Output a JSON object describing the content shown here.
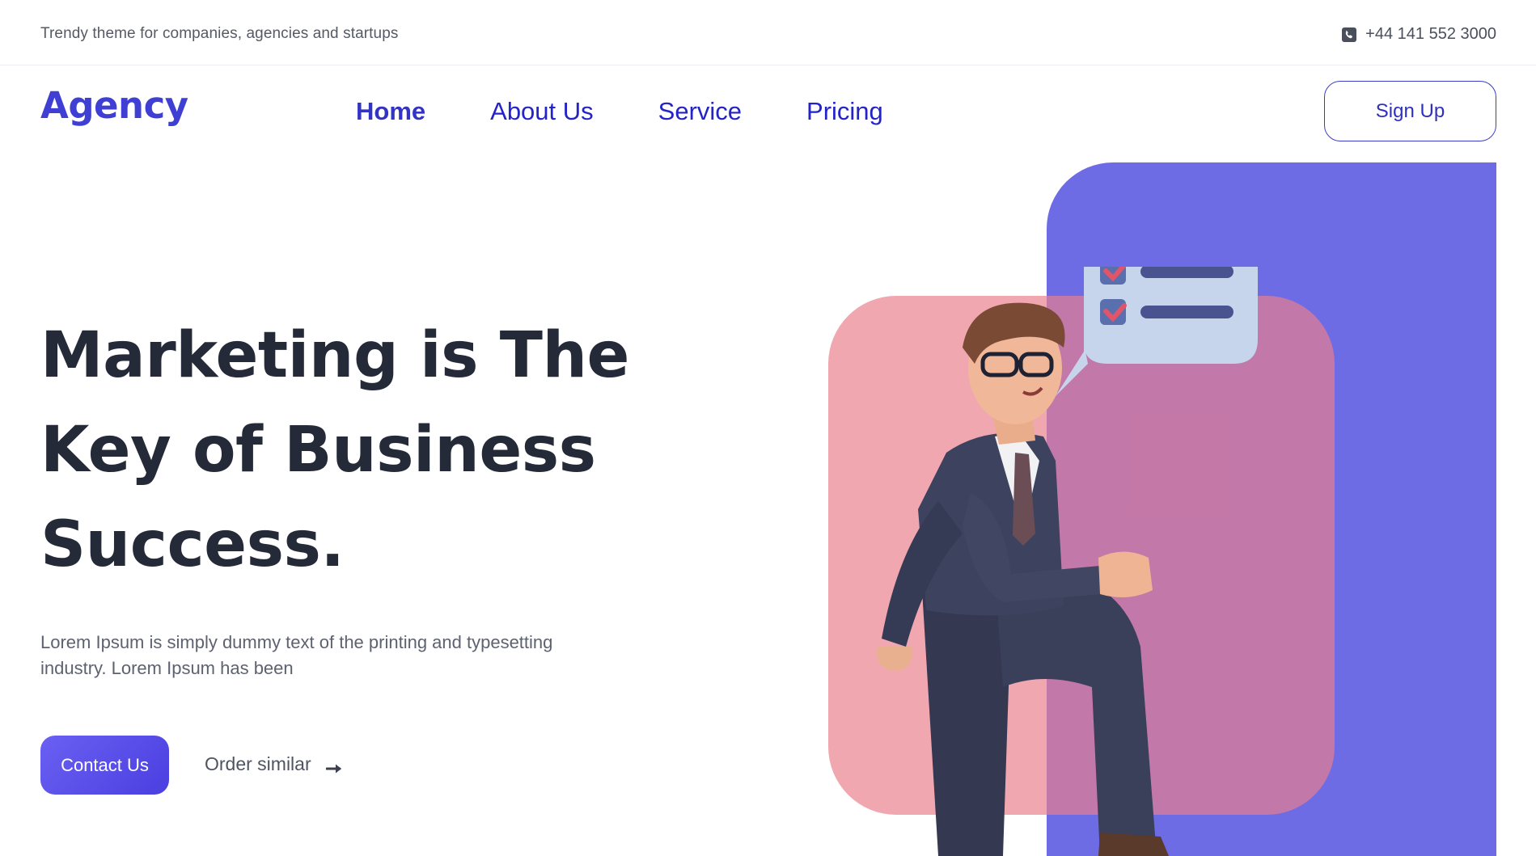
{
  "topbar": {
    "tagline": "Trendy theme for companies, agencies and startups",
    "phone": "+44 141 552 3000",
    "phone_icon": "phone-icon"
  },
  "header": {
    "logo": "Agency",
    "nav": [
      {
        "label": "Home",
        "active": true
      },
      {
        "label": "About Us",
        "active": false
      },
      {
        "label": "Service",
        "active": false
      },
      {
        "label": "Pricing",
        "active": false
      }
    ],
    "signup_label": "Sign Up"
  },
  "hero": {
    "title_lines": [
      "Marketing is The",
      "Key of Business",
      "Success."
    ],
    "description": "Lorem Ipsum is simply dummy text of the printing and typesetting industry. Lorem Ipsum has been",
    "contact_label": "Contact Us",
    "order_label": "Order similar",
    "order_icon": "arrow-right-icon",
    "illustration": "businessman-climbing-illustration",
    "speech_icon": "checklist-speech-bubble-icon"
  },
  "colors": {
    "brand": "#3f3fd4",
    "nav_link": "#2323c8",
    "heading": "#252a38",
    "blue_panel": "#6e6ce5",
    "pink_panel": "#eb7e8a",
    "button_gradient_start": "#6a60f2",
    "button_gradient_end": "#4a3fe0"
  }
}
